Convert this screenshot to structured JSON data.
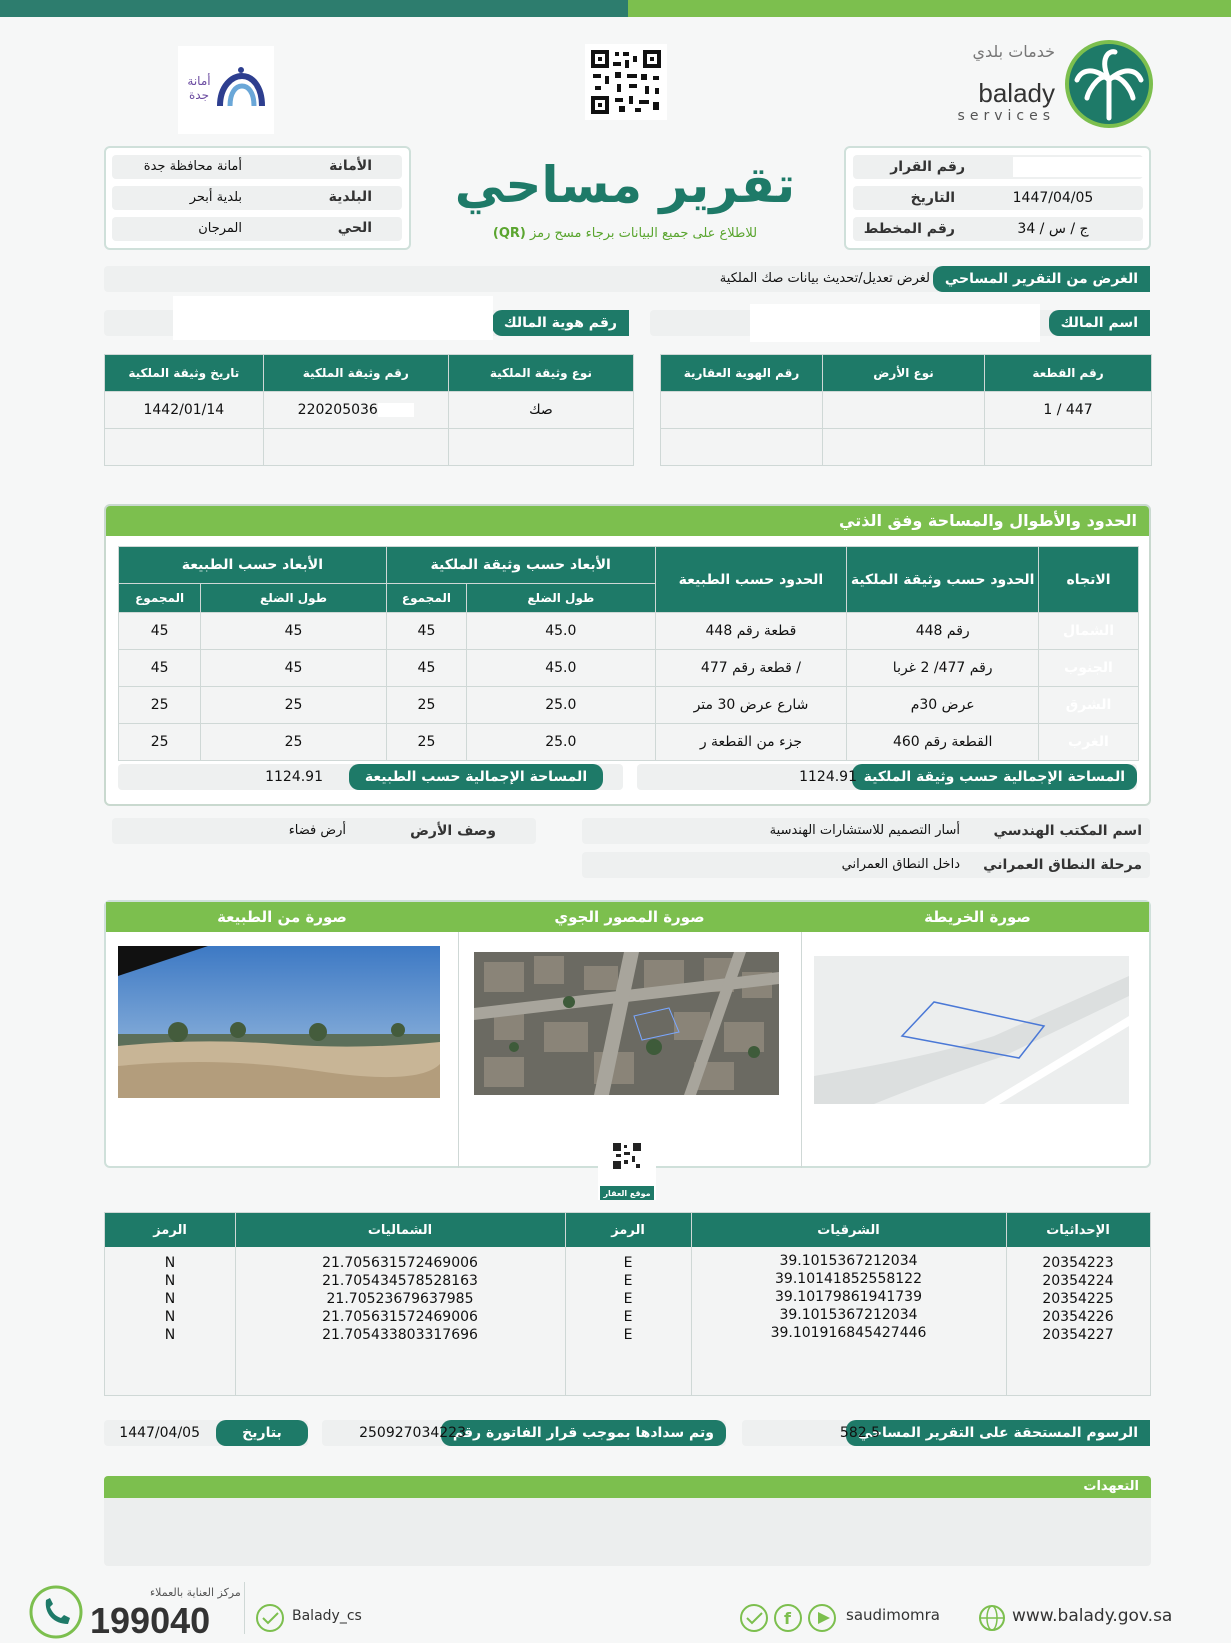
{
  "header": {
    "balady_ar": "خدمات بلدي",
    "balady_en": "balady",
    "balady_services": "services",
    "jeddah_logo_ar": "أمانة جدة",
    "title": "تقرير مساحي",
    "qr_hint_prefix": "للاطلاع على جميع البيانات برجاء مسح رمز",
    "qr_hint_code": "(QR)"
  },
  "decision": {
    "number_label": "رقم القرار",
    "number_value": "",
    "date_label": "التاريخ",
    "date_value": "1447/04/05",
    "plan_label": "رقم المخطط",
    "plan_value": "34 / ج / س"
  },
  "municipality": {
    "amana_label": "الأمانة",
    "amana_value": "أمانة محافظة جدة",
    "baladiya_label": "البلدية",
    "baladiya_value": "بلدية أبحر",
    "district_label": "الحي",
    "district_value": "المرجان"
  },
  "purpose": {
    "label": "الغرض من التقرير المساحي",
    "value": "لغرض تعديل/تحديث بيانات صك الملكية"
  },
  "owner": {
    "name_label": "اسم المالك",
    "id_label": "رقم هوية المالك"
  },
  "parcel_table": {
    "headers": [
      "رقم القطعة",
      "نوع الأرض",
      "رقم الهوية العقارية"
    ],
    "row": [
      "1 / 447",
      "",
      ""
    ]
  },
  "deed_table": {
    "headers": [
      "نوع وثيقة الملكية",
      "رقم وثيقة الملكية",
      "تاريخ وثيقة الملكية"
    ],
    "row": [
      "صك",
      "220205036",
      "1442/01/14"
    ]
  },
  "bounds": {
    "title": "الحدود والأطوال والمساحة وفق الذتي",
    "h_direction": "الاتجاه",
    "h_bounds_deed": "الحدود حسب وثيقة الملكية",
    "h_bounds_nature": "الحدود حسب الطبيعة",
    "h_dims_deed": "الأبعاد حسب وثيقة الملكية",
    "h_dims_nature": "الأبعاد حسب الطبيعة",
    "h_side_len": "طول الضلع",
    "h_total": "المجموع",
    "rows": [
      {
        "dir": "الشمال",
        "deed": "رقم 448",
        "nature": "قطعة رقم 448",
        "deed_len": "45.0",
        "deed_total": "45",
        "nat_len": "45",
        "nat_total": "45"
      },
      {
        "dir": "الجنوب",
        "deed": "رقم 477/ 2 غربا",
        "nature": "قطعة رقم 477 /",
        "deed_len": "45.0",
        "deed_total": "45",
        "nat_len": "45",
        "nat_total": "45"
      },
      {
        "dir": "الشرق",
        "deed": "عرض 30م",
        "nature": "شارع عرض 30 متر",
        "deed_len": "25.0",
        "deed_total": "25",
        "nat_len": "25",
        "nat_total": "25"
      },
      {
        "dir": "الغرب",
        "deed": "القطعة رقم 460",
        "nature": "جزء من القطعة ر",
        "deed_len": "25.0",
        "deed_total": "25",
        "nat_len": "25",
        "nat_total": "25"
      }
    ],
    "area_deed_label": "المساحة الإجمالية حسب وثيقة الملكية",
    "area_deed_value": "1124.91",
    "area_nature_label": "المساحة الإجمالية حسب الطبيعة",
    "area_nature_value": "1124.91"
  },
  "office": {
    "label": "اسم المكتب الهندسي",
    "value": "أسار التصميم للاستشارات الهندسية",
    "land_desc_label": "وصف الأرض",
    "land_desc_value": "أرض فضاء",
    "urban_label": "مرحلة النطاق العمراني",
    "urban_value": "داخل النطاق العمراني"
  },
  "images": {
    "map_label": "صورة الخريطة",
    "aerial_label": "صورة المصور الجوي",
    "nature_label": "صورة من الطبيعة",
    "site_label": "موقع العقار"
  },
  "coords": {
    "h_points": "الإحداثيات",
    "h_east": "الشرقيات",
    "h_code_e": "الرمز",
    "h_north": "الشماليات",
    "h_code_n": "الرمز",
    "rows": [
      {
        "pt": "20354223",
        "e": "39.1015367212034",
        "ce": "E",
        "n": "21.705631572469006",
        "cn": "N"
      },
      {
        "pt": "20354224",
        "e": "39.10141852558122",
        "ce": "E",
        "n": "21.705434578528163",
        "cn": "N"
      },
      {
        "pt": "20354225",
        "e": "39.10179861941739",
        "ce": "E",
        "n": "21.70523679637985",
        "cn": "N"
      },
      {
        "pt": "20354226",
        "e": "39.1015367212034",
        "ce": "E",
        "n": "21.705631572469006",
        "cn": "N"
      },
      {
        "pt": "20354227",
        "e": "39.101916845427446",
        "ce": "E",
        "n": "21.705433803317696",
        "cn": "N"
      }
    ]
  },
  "fees": {
    "fee_label": "الرسوم المستحقة على التقرير المساحي",
    "fee_value": "582.5",
    "paid_label": "وتم سدادها بموجب قرار الفاتورة رقم",
    "paid_value": "250927034223",
    "date_label": "بتاريخ",
    "date_value": "1447/04/05"
  },
  "pledges": {
    "label": "التعهدات"
  },
  "footer": {
    "site": "www.balady.gov.sa",
    "social": "saudimomra",
    "twitter": "Balady_cs",
    "care_label": "مركز العناية بالعملاء",
    "phone": "199040"
  },
  "colors": {
    "primary": "#1e7a68",
    "accent": "#7cbf4e"
  }
}
